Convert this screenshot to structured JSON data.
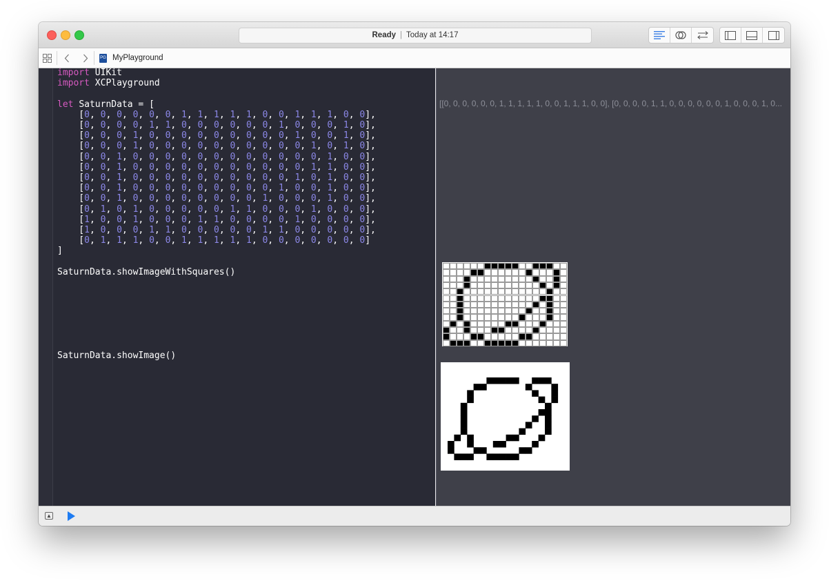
{
  "titlebar": {
    "status": "Ready",
    "timestamp": "Today at 14:17"
  },
  "jumpbar": {
    "file_name": "MyPlayground",
    "file_icon_text": "PG"
  },
  "editor": {
    "imports": [
      "UIKit",
      "XCPlayground"
    ],
    "import_keyword": "import",
    "let_keyword": "let",
    "variable_name": "SaturnData",
    "matrix": [
      [
        0,
        0,
        0,
        0,
        0,
        0,
        1,
        1,
        1,
        1,
        1,
        0,
        0,
        1,
        1,
        1,
        0,
        0
      ],
      [
        0,
        0,
        0,
        0,
        1,
        1,
        0,
        0,
        0,
        0,
        0,
        0,
        1,
        0,
        0,
        0,
        1,
        0
      ],
      [
        0,
        0,
        0,
        1,
        0,
        0,
        0,
        0,
        0,
        0,
        0,
        0,
        0,
        1,
        0,
        0,
        1,
        0
      ],
      [
        0,
        0,
        0,
        1,
        0,
        0,
        0,
        0,
        0,
        0,
        0,
        0,
        0,
        0,
        1,
        0,
        1,
        0
      ],
      [
        0,
        0,
        1,
        0,
        0,
        0,
        0,
        0,
        0,
        0,
        0,
        0,
        0,
        0,
        0,
        1,
        0,
        0
      ],
      [
        0,
        0,
        1,
        0,
        0,
        0,
        0,
        0,
        0,
        0,
        0,
        0,
        0,
        0,
        1,
        1,
        0,
        0
      ],
      [
        0,
        0,
        1,
        0,
        0,
        0,
        0,
        0,
        0,
        0,
        0,
        0,
        0,
        1,
        0,
        1,
        0,
        0
      ],
      [
        0,
        0,
        1,
        0,
        0,
        0,
        0,
        0,
        0,
        0,
        0,
        0,
        1,
        0,
        0,
        1,
        0,
        0
      ],
      [
        0,
        0,
        1,
        0,
        0,
        0,
        0,
        0,
        0,
        0,
        0,
        1,
        0,
        0,
        0,
        1,
        0,
        0
      ],
      [
        0,
        1,
        0,
        1,
        0,
        0,
        0,
        0,
        0,
        1,
        1,
        0,
        0,
        0,
        1,
        0,
        0,
        0
      ],
      [
        1,
        0,
        0,
        1,
        0,
        0,
        0,
        1,
        1,
        0,
        0,
        0,
        0,
        1,
        0,
        0,
        0,
        0
      ],
      [
        1,
        0,
        0,
        0,
        1,
        1,
        0,
        0,
        0,
        0,
        0,
        1,
        1,
        0,
        0,
        0,
        0,
        0
      ],
      [
        0,
        1,
        1,
        1,
        0,
        0,
        1,
        1,
        1,
        1,
        1,
        0,
        0,
        0,
        0,
        0,
        0,
        0
      ]
    ],
    "call_squares": "SaturnData.showImageWithSquares()",
    "call_image": "SaturnData.showImage()"
  },
  "results": {
    "array_preview": "[[0, 0, 0, 0, 0, 0, 1, 1, 1, 1, 1, 0, 0, 1, 1, 1, 0, 0], [0, 0, 0, 0, 1, 1, 0, 0, 0, 0, 0, 0, 1, 0, 0, 0, 1, 0..."
  },
  "colors": {
    "keyword": "#d65ac1",
    "number": "#8c88e8",
    "editor_bg": "#292a35",
    "results_bg": "#3f4049"
  },
  "icons": {
    "navigator": "grid-icon",
    "back": "chevron-left-icon",
    "forward": "chevron-right-icon",
    "standard_editor": "lines-icon",
    "assistant_editor": "venn-icon",
    "version_editor": "swap-arrows-icon",
    "left_panel": "left-panel-icon",
    "bottom_panel": "bottom-panel-icon",
    "right_panel": "right-panel-icon",
    "hide_debug": "hide-debug-icon",
    "run": "play-icon"
  }
}
